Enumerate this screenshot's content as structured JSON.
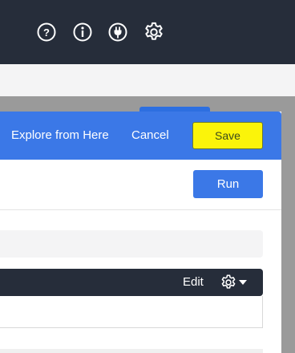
{
  "topbar": {
    "icons": [
      {
        "name": "help-icon"
      },
      {
        "name": "info-icon"
      },
      {
        "name": "plug-icon"
      },
      {
        "name": "gear-icon"
      }
    ]
  },
  "panel_header": {
    "explore_label": "Explore from Here",
    "cancel_label": "Cancel",
    "save_label": "Save"
  },
  "toolbar": {
    "run_label": "Run"
  },
  "data_section": {
    "edit_label": "Edit",
    "settings_icon": "gear-icon"
  },
  "colors": {
    "topbar": "#262d3a",
    "header_blue": "#3b78e7",
    "save_yellow": "#fbf40a"
  }
}
